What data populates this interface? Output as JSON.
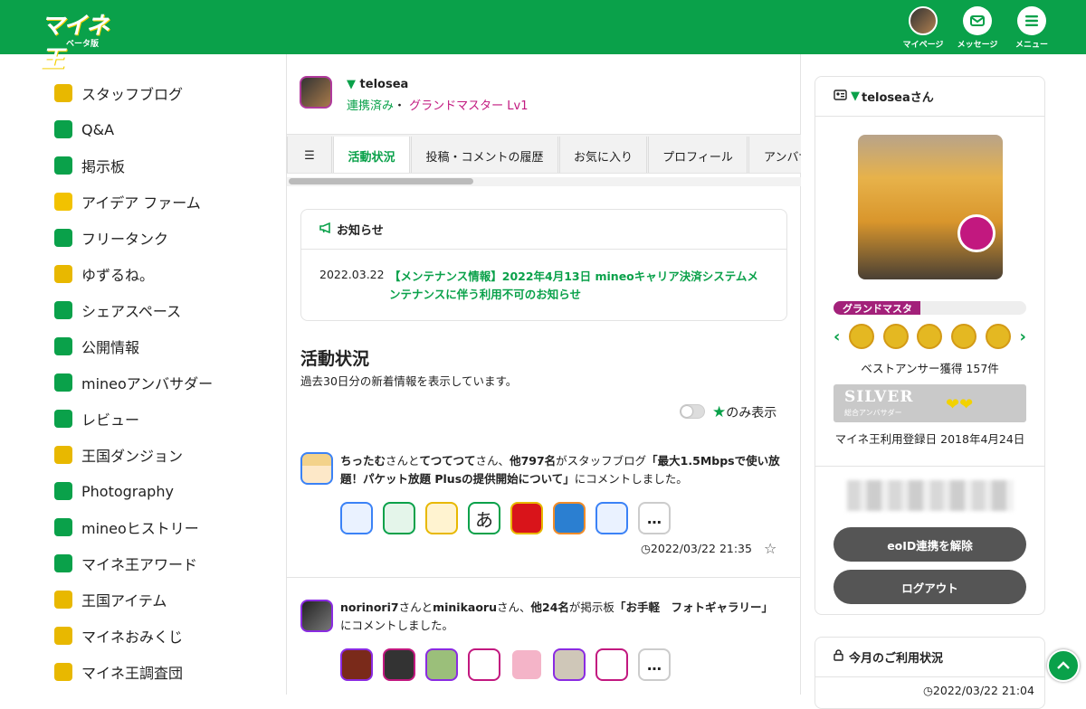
{
  "header": {
    "logo": "マイネ王",
    "logo_sub": "ベータ版",
    "nav": [
      {
        "label": "マイページ",
        "icon": "avatar"
      },
      {
        "label": "メッセージ",
        "icon": "mail-icon"
      },
      {
        "label": "メニュー",
        "icon": "menu-icon"
      }
    ]
  },
  "sidebar": {
    "items": [
      {
        "label": "スタッフブログ",
        "icon": "staff-blog-icon",
        "color": "#e8b800"
      },
      {
        "label": "Q&A",
        "icon": "qa-icon",
        "color": "#0aa14a"
      },
      {
        "label": "掲示板",
        "icon": "bbs-icon",
        "color": "#0aa14a"
      },
      {
        "label": "アイデア ファーム",
        "icon": "idea-icon",
        "color": "#f2c200"
      },
      {
        "label": "フリータンク",
        "icon": "tank-icon",
        "color": "#0aa14a"
      },
      {
        "label": "ゆずるね。",
        "icon": "yuzurune-icon",
        "color": "#e8b800"
      },
      {
        "label": "シェアスペース",
        "icon": "share-space-icon",
        "color": "#0aa14a"
      },
      {
        "label": "公開情報",
        "icon": "chart-icon",
        "color": "#0aa14a"
      },
      {
        "label": "mineoアンバサダー",
        "icon": "ambassador-icon",
        "color": "#0aa14a"
      },
      {
        "label": "レビュー",
        "icon": "review-icon",
        "color": "#0aa14a"
      },
      {
        "label": "王国ダンジョン",
        "icon": "dungeon-icon",
        "color": "#e8b800"
      },
      {
        "label": "Photography",
        "icon": "camera-icon",
        "color": "#0aa14a"
      },
      {
        "label": "mineoヒストリー",
        "icon": "history-icon",
        "color": "#0aa14a"
      },
      {
        "label": "マイネ王アワード",
        "icon": "trophy-icon",
        "color": "#0aa14a"
      },
      {
        "label": "王国アイテム",
        "icon": "item-icon",
        "color": "#e8b800"
      },
      {
        "label": "マイネおみくじ",
        "icon": "omikuji-icon",
        "color": "#e8b800"
      },
      {
        "label": "マイネ王調査団",
        "icon": "survey-icon",
        "color": "#e8b800"
      }
    ]
  },
  "profile": {
    "name": "telosea",
    "linked": "連携済み",
    "separator": "・",
    "rank": "グランドマスター Lv1"
  },
  "tabs": [
    {
      "label": "☰"
    },
    {
      "label": "活動状況",
      "active": true
    },
    {
      "label": "投稿・コメントの履歴"
    },
    {
      "label": "お気に入り"
    },
    {
      "label": "プロフィール"
    },
    {
      "label": "アンバサ"
    }
  ],
  "notice": {
    "title": "お知らせ",
    "date": "2022.03.22",
    "text": "【メンテナンス情報】2022年4月13日 mineoキャリア決済システムメンテナンスに伴う利用不可のお知らせ"
  },
  "activity": {
    "title": "活動状況",
    "subtitle": "過去30日分の新着情報を表示しています。",
    "filter_label": "のみ表示"
  },
  "feed": [
    {
      "u1": "ちったむ",
      "mid1": "さんと",
      "u2": "てつてつて",
      "mid2": "さん、",
      "count": "他797名",
      "mid3": "がスタッフブログ",
      "target": "「最大1.5Mbpsで使い放題！パケット放題 Plusの提供開始について」",
      "tail": "にコメントしました。",
      "time": "2022/03/22 21:35",
      "more": "…"
    },
    {
      "u1": "norinori7",
      "mid1": "さんと",
      "u2": "minikaoru",
      "mid2": "さん、",
      "count": "他24名",
      "mid3": "が掲示板",
      "target": "「お手軽　フォトギャラリー」",
      "tail": "にコメントしました。",
      "more": "…"
    }
  ],
  "right_panel": {
    "title": "teloseaさん",
    "rank_label": "グランドマスタ",
    "rank_progress": 0.45,
    "best_answer": "ベストアンサー獲得 157件",
    "silver_title": "SILVER",
    "silver_sub": "総合アンバサダー",
    "registered": "マイネ王利用登録日 2018年4月24日",
    "unlink_button": "eoID連携を解除",
    "logout_button": "ログアウト",
    "usage_title": "今月のご利用状況",
    "usage_date": "2022/03/22 21:04"
  },
  "colors": {
    "brand": "#0aa14a",
    "rank": "#c2187f",
    "badge": "#e4b822"
  }
}
